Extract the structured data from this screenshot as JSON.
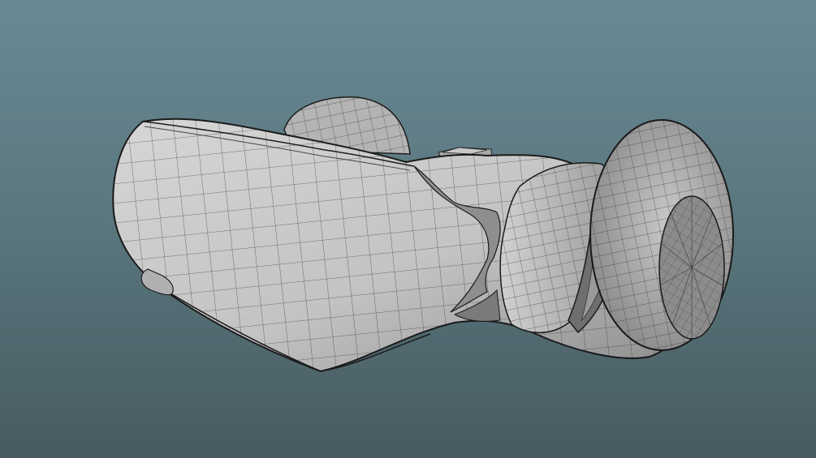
{
  "viewport": {
    "background_top": "#6a8993",
    "background_bottom": "#475b60",
    "model": {
      "description_name": "subdivision-mesh",
      "shading": "flat-gray-with-wireframe",
      "surface_color": "#b9b9b9",
      "surface_dark": "#6f6f6f",
      "wire_color": "#1c1c1c"
    }
  }
}
